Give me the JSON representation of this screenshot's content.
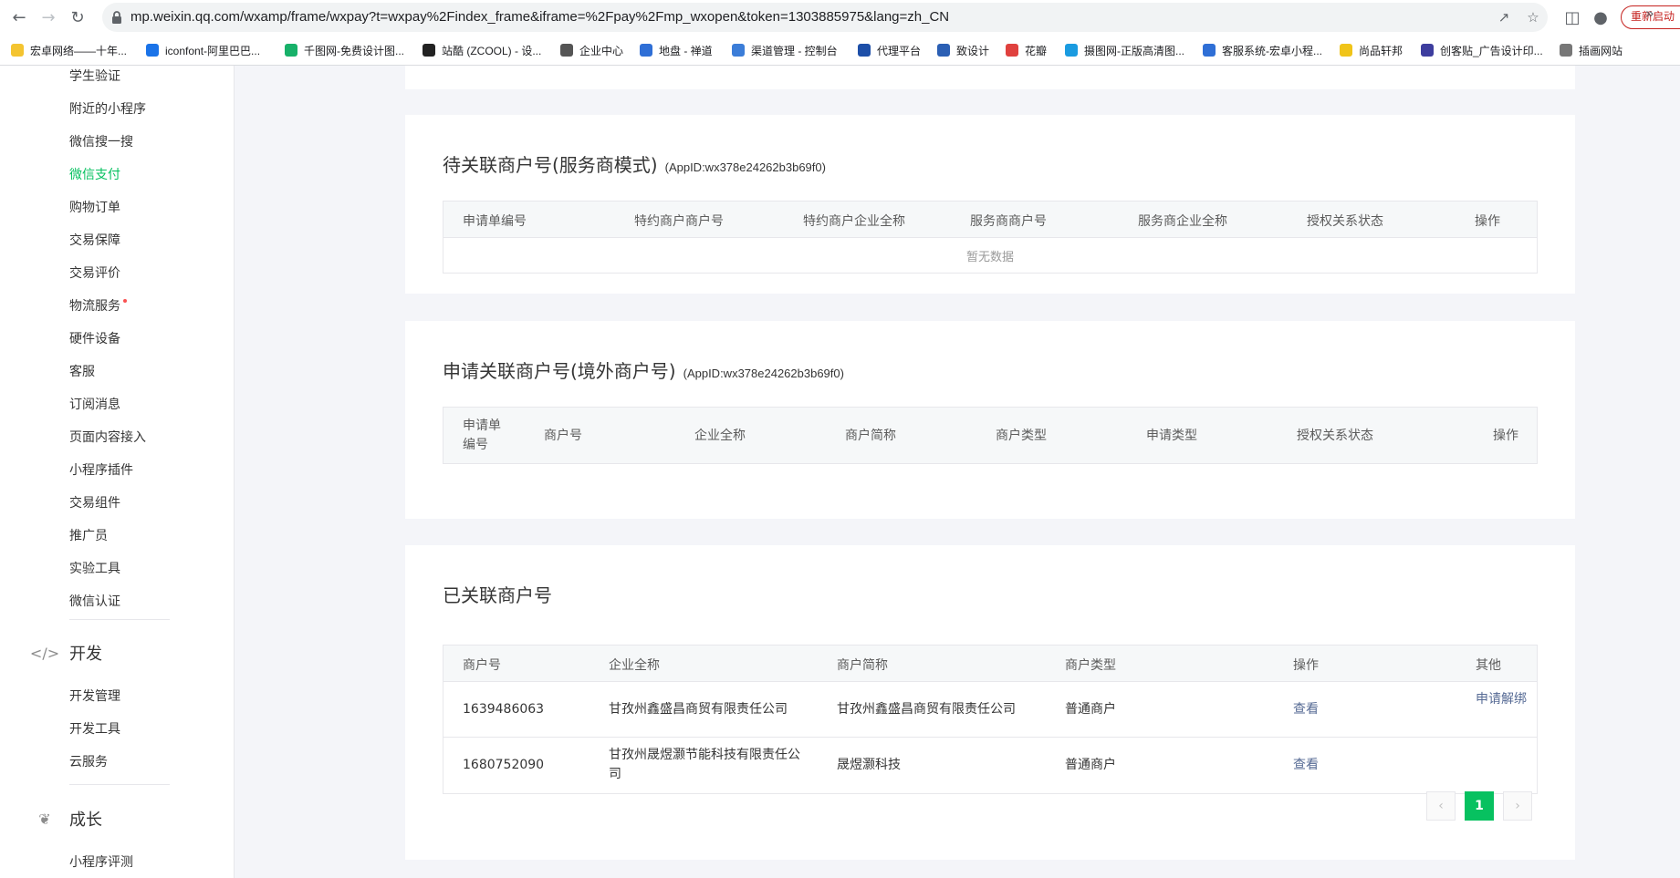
{
  "browser": {
    "url": "mp.weixin.qq.com/wxamp/frame/wxpay?t=wxpay%2Findex_frame&iframe=%2Fpay%2Fmp_wxopen&token=1303885975&lang=zh_CN",
    "relaunch_label": "重新启动",
    "bookmarks": [
      {
        "label": "宏卓网络——十年...",
        "color": "#f4c430"
      },
      {
        "label": "iconfont-阿里巴巴...",
        "color": "#1a73e8"
      },
      {
        "label": "千图网-免费设计图...",
        "color": "#17b169"
      },
      {
        "label": "站酷 (ZCOOL) - 设...",
        "color": "#222222"
      },
      {
        "label": "企业中心",
        "color": "#555555"
      },
      {
        "label": "地盘 - 禅道",
        "color": "#2f6fd6"
      },
      {
        "label": "渠道管理 - 控制台",
        "color": "#3b7dd8"
      },
      {
        "label": "代理平台",
        "color": "#1d4fa8"
      },
      {
        "label": "致设计",
        "color": "#2b5fb4"
      },
      {
        "label": "花瓣",
        "color": "#e0413e"
      },
      {
        "label": "摄图网-正版高清图...",
        "color": "#1a9be0"
      },
      {
        "label": "客服系统-宏卓小程...",
        "color": "#2f6fd6"
      },
      {
        "label": "尚品轩邦",
        "color": "#f0c419"
      },
      {
        "label": "创客贴_广告设计印...",
        "color": "#3d3d9e"
      },
      {
        "label": "插画网站",
        "color": "#777777"
      }
    ]
  },
  "sidebar": {
    "items": [
      {
        "label": "学生验证",
        "active": false,
        "dot": false
      },
      {
        "label": "附近的小程序",
        "active": false,
        "dot": false
      },
      {
        "label": "微信搜一搜",
        "active": false,
        "dot": false
      },
      {
        "label": "微信支付",
        "active": true,
        "dot": false
      },
      {
        "label": "购物订单",
        "active": false,
        "dot": false
      },
      {
        "label": "交易保障",
        "active": false,
        "dot": false
      },
      {
        "label": "交易评价",
        "active": false,
        "dot": false
      },
      {
        "label": "物流服务",
        "active": false,
        "dot": true
      },
      {
        "label": "硬件设备",
        "active": false,
        "dot": false
      },
      {
        "label": "客服",
        "active": false,
        "dot": false
      },
      {
        "label": "订阅消息",
        "active": false,
        "dot": false
      },
      {
        "label": "页面内容接入",
        "active": false,
        "dot": false
      },
      {
        "label": "小程序插件",
        "active": false,
        "dot": false
      },
      {
        "label": "交易组件",
        "active": false,
        "dot": false
      },
      {
        "label": "推广员",
        "active": false,
        "dot": false
      },
      {
        "label": "实验工具",
        "active": false,
        "dot": false
      },
      {
        "label": "微信认证",
        "active": false,
        "dot": false
      }
    ],
    "dev_group": {
      "label": "开发",
      "icon": "code-icon",
      "items": [
        "开发管理",
        "开发工具",
        "云服务"
      ]
    },
    "growth_group": {
      "label": "成长",
      "icon": "sprout-icon",
      "items": [
        "小程序评测"
      ]
    }
  },
  "panel_service": {
    "title": "待关联商户号(服务商模式)",
    "appid": "(AppID:wx378e24262b3b69f0)",
    "headers": [
      "申请单编号",
      "特约商户商户号",
      "特约商户企业全称",
      "服务商商户号",
      "服务商企业全称",
      "授权关系状态",
      "操作"
    ],
    "empty_text": "暂无数据"
  },
  "panel_overseas": {
    "title": "申请关联商户号(境外商户号)",
    "appid": "(AppID:wx378e24262b3b69f0)",
    "headers": [
      "申请单编号",
      "商户号",
      "企业全称",
      "商户简称",
      "商户类型",
      "申请类型",
      "授权关系状态",
      "操作"
    ]
  },
  "panel_linked": {
    "title": "已关联商户号",
    "headers": [
      "商户号",
      "企业全称",
      "商户简称",
      "商户类型",
      "操作",
      "其他"
    ],
    "rows": [
      {
        "mch_id": "1639486063",
        "full_name": "甘孜州鑫盛昌商贸有限责任公司",
        "short_name": "甘孜州鑫盛昌商贸有限责任公司",
        "type": "普通商户",
        "action": "查看",
        "other": "申请解绑"
      },
      {
        "mch_id": "1680752090",
        "full_name": "甘孜州晟煜灏节能科技有限责任公司",
        "short_name": "晟煜灏科技",
        "type": "普通商户",
        "action": "查看",
        "other": ""
      }
    ],
    "pagination": {
      "current": "1",
      "prev": "‹",
      "next": "›"
    }
  },
  "colors": {
    "accent": "#07c160",
    "link": "#576b95",
    "danger": "#fa5151"
  }
}
